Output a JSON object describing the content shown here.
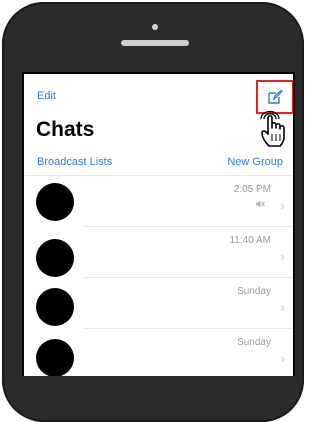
{
  "nav": {
    "edit_label": "Edit",
    "compose_icon": "compose-icon"
  },
  "title": "Chats",
  "links": {
    "broadcast_label": "Broadcast Lists",
    "new_group_label": "New Group"
  },
  "chats": [
    {
      "time": "2:05 PM",
      "muted": true
    },
    {
      "time": "11:40 AM",
      "muted": false
    },
    {
      "time": "Sunday",
      "muted": false
    },
    {
      "time": "Sunday",
      "muted": false
    }
  ],
  "colors": {
    "accent": "#2b7be4",
    "highlight": "#e52222",
    "phone": "#2b2b2b"
  }
}
